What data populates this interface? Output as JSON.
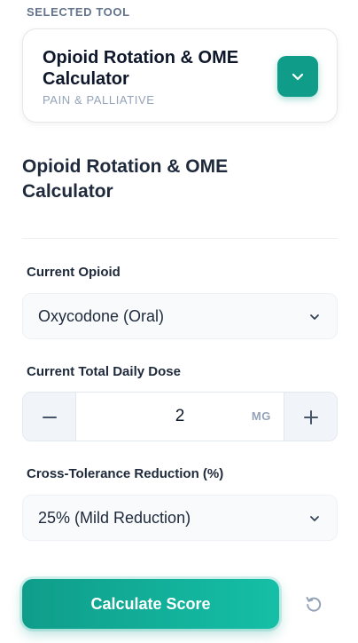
{
  "selected_tool": {
    "section_label": "SELECTED TOOL",
    "title": "Opioid Rotation & OME Calculator",
    "category": "PAIN & PALLIATIVE",
    "toggle_icon": "chevron-down-icon"
  },
  "page": {
    "title": "Opioid Rotation & OME Calculator"
  },
  "fields": {
    "current_opioid": {
      "label": "Current Opioid",
      "value": "Oxycodone (Oral)"
    },
    "daily_dose": {
      "label": "Current Total Daily Dose",
      "value": "2",
      "unit": "MG"
    },
    "cross_tolerance": {
      "label": "Cross-Tolerance Reduction (%)",
      "value": "25% (Mild Reduction)"
    }
  },
  "actions": {
    "calculate_label": "Calculate Score",
    "reset_icon": "reset-icon"
  },
  "colors": {
    "accent": "#0f9d8a",
    "accent_light": "#15bfa6",
    "text": "#1e293b",
    "muted": "#94a3b8"
  }
}
